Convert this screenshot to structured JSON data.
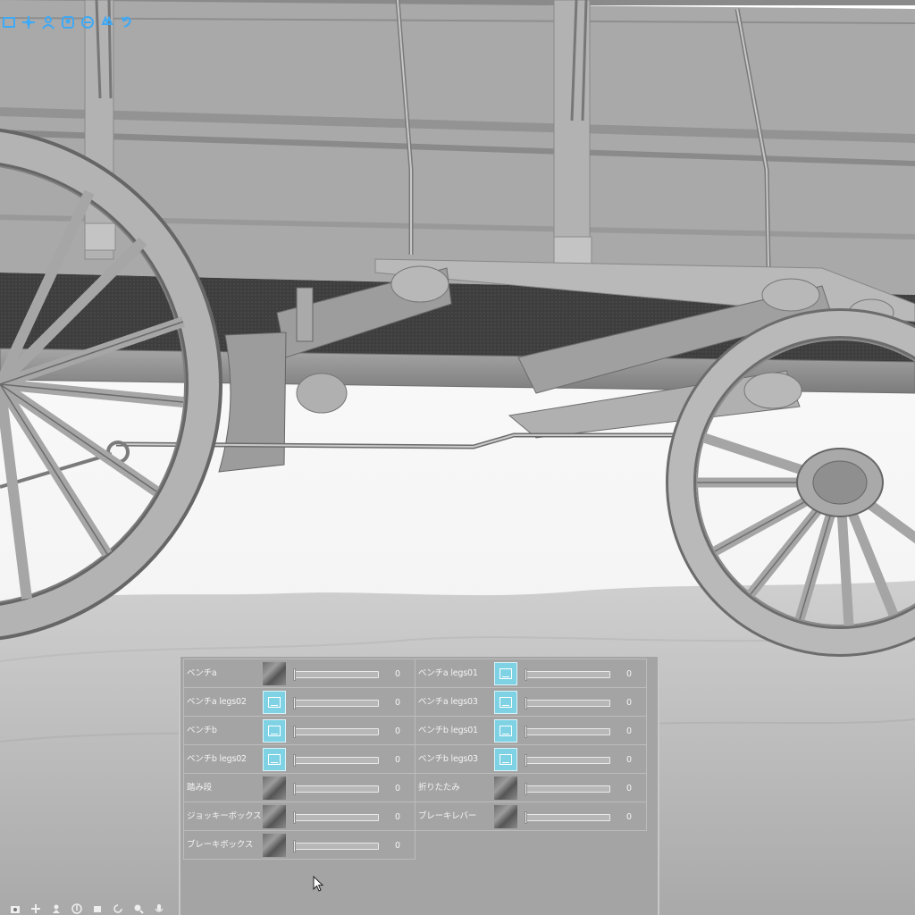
{
  "toolbar": {
    "top_icons": [
      "camera-frame-icon",
      "move-cross-icon",
      "pose-figure-icon",
      "bust-figure-icon",
      "head-figure-icon",
      "hand-figure-icon",
      "undo-arrow-icon"
    ],
    "bottom_icons": [
      "camera-icon",
      "pan-icon",
      "figure-rotate-icon",
      "compass-icon",
      "camera-rotate-icon",
      "refresh-icon",
      "zoom-figure-icon",
      "microphone-icon"
    ]
  },
  "colors": {
    "panel_bg": "#a4a4a4",
    "thumb_noimage": "#7fd2e4",
    "icon_blue": "#3fa9f5"
  },
  "morph_panel": {
    "items": [
      {
        "label": "ベンチa",
        "thumb": "photo",
        "value": "0"
      },
      {
        "label": "ベンチa legs01",
        "thumb": "noimage",
        "value": "0"
      },
      {
        "label": "ベンチa legs02",
        "thumb": "noimage",
        "value": "0"
      },
      {
        "label": "ベンチa legs03",
        "thumb": "noimage",
        "value": "0"
      },
      {
        "label": "ベンチb",
        "thumb": "noimage",
        "value": "0"
      },
      {
        "label": "ベンチb legs01",
        "thumb": "noimage",
        "value": "0"
      },
      {
        "label": "ベンチb legs02",
        "thumb": "noimage",
        "value": "0"
      },
      {
        "label": "ベンチb legs03",
        "thumb": "noimage",
        "value": "0"
      },
      {
        "label": "踏み段",
        "thumb": "photo",
        "value": "0"
      },
      {
        "label": "折りたたみ",
        "thumb": "photo",
        "value": "0"
      },
      {
        "label": "ジョッキーボックス",
        "thumb": "photo",
        "value": "0"
      },
      {
        "label": "ブレーキレバー",
        "thumb": "photo",
        "value": "0"
      },
      {
        "label": "ブレーキボックス",
        "thumb": "photo",
        "value": "0"
      }
    ]
  }
}
